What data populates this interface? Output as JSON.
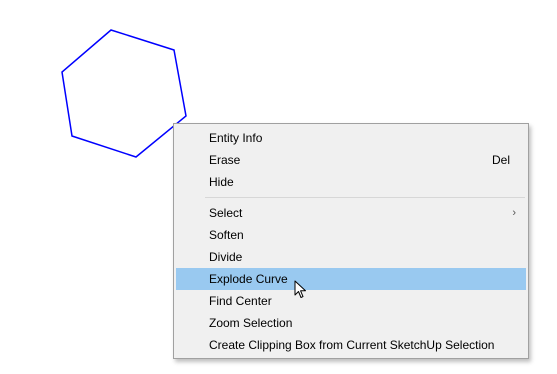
{
  "colors": {
    "shape_stroke": "#0000ff",
    "menu_background": "#f0f0f0",
    "menu_highlight": "#99c9f0"
  },
  "context_menu": {
    "groups": [
      [
        {
          "label": "Entity Info",
          "shortcut": ""
        },
        {
          "label": "Erase",
          "shortcut": "Del"
        },
        {
          "label": "Hide",
          "shortcut": ""
        }
      ],
      [
        {
          "label": "Select",
          "submenu": true
        },
        {
          "label": "Soften"
        },
        {
          "label": "Divide"
        },
        {
          "label": "Explode Curve",
          "highlighted": true
        },
        {
          "label": "Find Center"
        },
        {
          "label": "Zoom Selection"
        },
        {
          "label": "Create Clipping Box from Current SketchUp Selection"
        }
      ]
    ],
    "submenu_arrow_glyph": "›"
  },
  "icons": {
    "cursor": "arrow-pointer-icon"
  }
}
